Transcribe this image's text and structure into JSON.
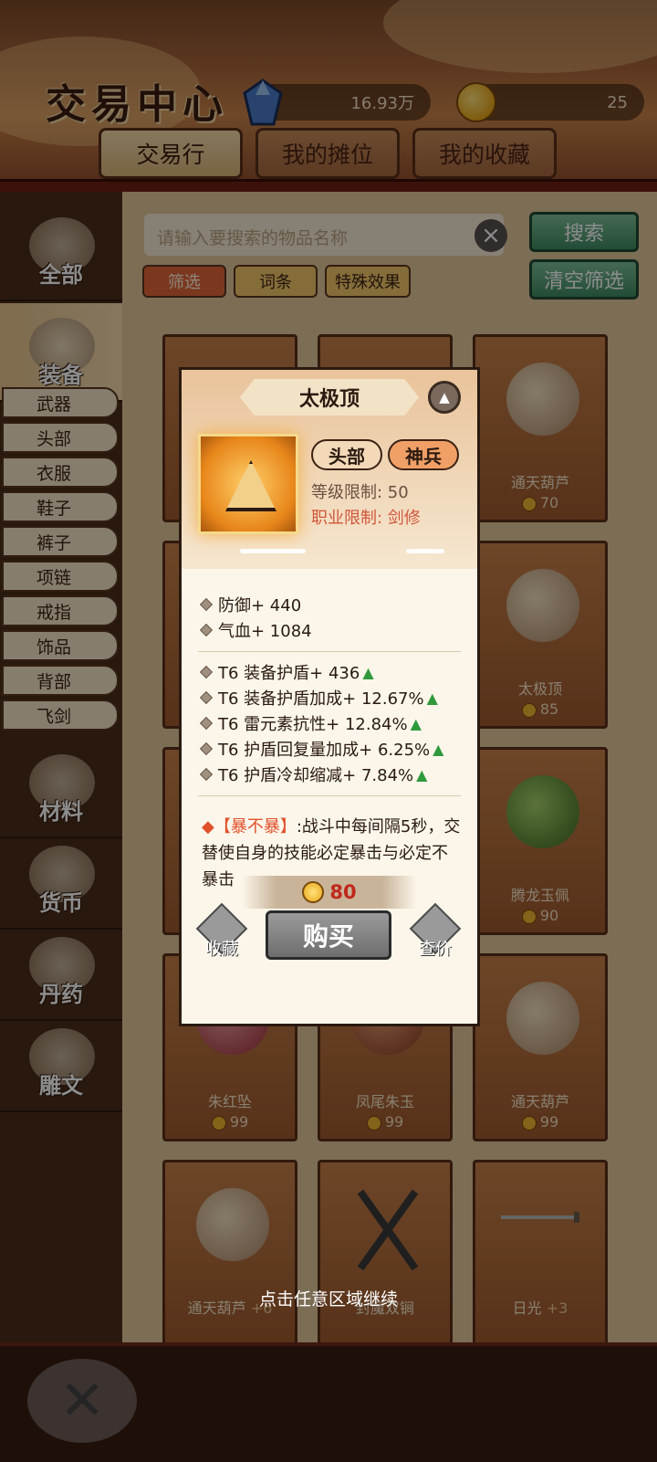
{
  "header": {
    "title": "交易中心",
    "gem_amount": "16.93万",
    "coin_amount": "25",
    "tabs": [
      {
        "label": "交易行",
        "active": true
      },
      {
        "label": "我的摊位",
        "active": false
      },
      {
        "label": "我的收藏",
        "active": false
      }
    ]
  },
  "sidebar": {
    "categories": [
      {
        "label": "全部",
        "active": false
      },
      {
        "label": "装备",
        "active": true
      },
      {
        "label": "材料",
        "active": false
      },
      {
        "label": "货币",
        "active": false
      },
      {
        "label": "丹药",
        "active": false
      },
      {
        "label": "雕文",
        "active": false
      }
    ],
    "sub_items": [
      "武器",
      "头部",
      "衣服",
      "鞋子",
      "裤子",
      "项链",
      "戒指",
      "饰品",
      "背部",
      "飞剑"
    ]
  },
  "search": {
    "placeholder": "请输入要搜索的物品名称",
    "search_label": "搜索",
    "clear_filter_label": "清空筛选"
  },
  "filters": [
    "筛选",
    "词条",
    "特殊效果"
  ],
  "grid": [
    {
      "name": "通天葫芦",
      "price": "70"
    },
    {
      "name": "太极顶",
      "price": "85"
    },
    {
      "name": "腾龙玉佩",
      "price": "90"
    },
    {
      "name": "朱红坠",
      "price": "99"
    },
    {
      "name": "凤尾朱玉",
      "price": "99"
    },
    {
      "name": "通天葫芦",
      "price": "99"
    },
    {
      "name": "通天葫芦",
      "plus": "+6",
      "price": ""
    },
    {
      "name": "封魔双锏",
      "price": ""
    },
    {
      "name": "日光",
      "plus": "+3",
      "price": ""
    }
  ],
  "popup": {
    "title": "太极顶",
    "tag_part": "头部",
    "tag_rank": "神兵",
    "level_req": "等级限制: 50",
    "job_req": "职业限制: 剑修",
    "base_stats": [
      "防御+ 440",
      "气血+ 1084"
    ],
    "affixes": [
      "T6 装备护盾+ 436",
      "T6 装备护盾加成+ 12.67%",
      "T6 雷元素抗性+ 12.84%",
      "T6 护盾回复量加成+ 6.25%",
      "T6 护盾冷却缩减+ 7.84%"
    ],
    "special_marker": "◆",
    "special_name": "【暴不暴】",
    "special_desc": ":战斗中每间隔5秒，交替使自身的技能必定暴击与必定不暴击",
    "price": "80",
    "buy_label": "购买",
    "favorite_label": "收藏",
    "check_price_label": "查价"
  },
  "hint": "点击任意区域继续",
  "colors": {
    "accent_red": "#e0502a",
    "price_red": "#c0281a",
    "up_green": "#2f9a3c",
    "search_green": "#3f8a62"
  }
}
